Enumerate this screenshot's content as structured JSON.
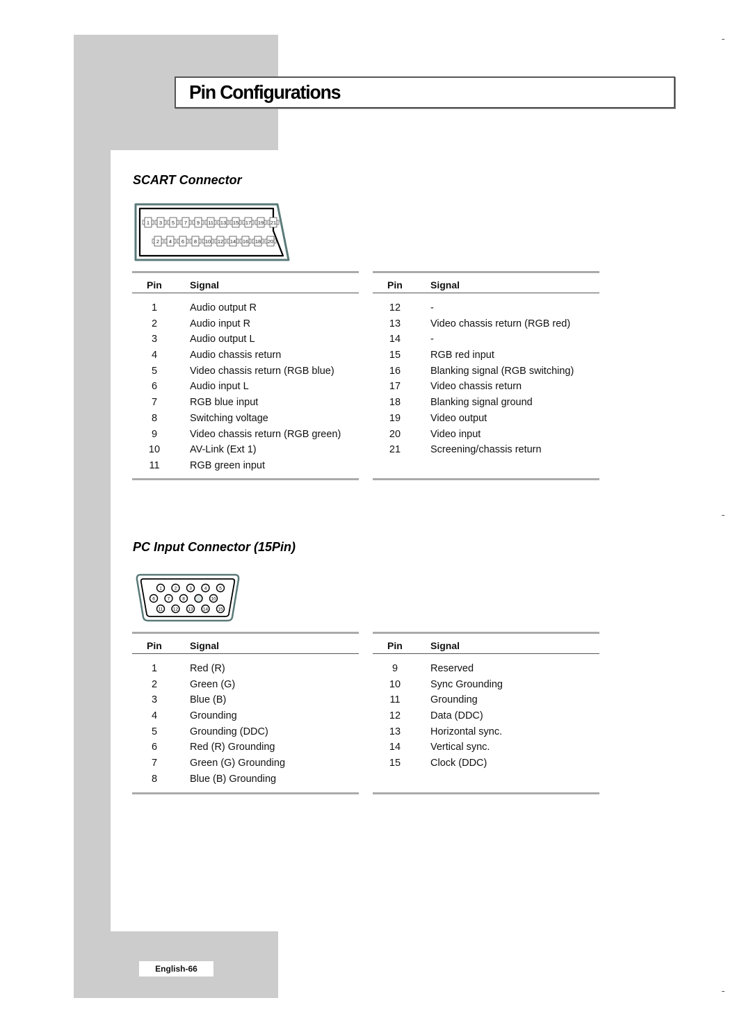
{
  "page": {
    "title": "Pin Configurations",
    "footer": "English-66"
  },
  "scart": {
    "section_title": "SCART Connector",
    "diagram": {
      "top_row_pins": [
        "1",
        "3",
        "5",
        "7",
        "9",
        "11",
        "13",
        "15",
        "17",
        "19",
        "21"
      ],
      "bottom_row_pins": [
        "2",
        "4",
        "6",
        "8",
        "10",
        "12",
        "14",
        "16",
        "18",
        "20"
      ]
    },
    "left_table": {
      "header_pin": "Pin",
      "header_signal": "Signal",
      "rows": [
        {
          "pin": "1",
          "signal": "Audio output R"
        },
        {
          "pin": "2",
          "signal": "Audio input R"
        },
        {
          "pin": "3",
          "signal": "Audio output L"
        },
        {
          "pin": "4",
          "signal": "Audio chassis return"
        },
        {
          "pin": "5",
          "signal": "Video chassis return (RGB blue)"
        },
        {
          "pin": "6",
          "signal": "Audio input L"
        },
        {
          "pin": "7",
          "signal": "RGB blue input"
        },
        {
          "pin": "8",
          "signal": "Switching voltage"
        },
        {
          "pin": "9",
          "signal": "Video chassis return (RGB green)"
        },
        {
          "pin": "10",
          "signal": "AV-Link (Ext 1)"
        },
        {
          "pin": "11",
          "signal": "RGB green input"
        }
      ]
    },
    "right_table": {
      "header_pin": "Pin",
      "header_signal": "Signal",
      "rows": [
        {
          "pin": "12",
          "signal": "-"
        },
        {
          "pin": "13",
          "signal": "Video chassis return (RGB red)"
        },
        {
          "pin": "14",
          "signal": "-"
        },
        {
          "pin": "15",
          "signal": "RGB red input"
        },
        {
          "pin": "16",
          "signal": "Blanking signal (RGB switching)"
        },
        {
          "pin": "17",
          "signal": "Video chassis return"
        },
        {
          "pin": "18",
          "signal": "Blanking signal ground"
        },
        {
          "pin": "19",
          "signal": "Video output"
        },
        {
          "pin": "20",
          "signal": "Video input"
        },
        {
          "pin": "21",
          "signal": "Screening/chassis return"
        }
      ]
    }
  },
  "pc": {
    "section_title": "PC Input Connector (15Pin)",
    "diagram": {
      "row1": [
        "1",
        "2",
        "3",
        "4",
        "5"
      ],
      "row2": [
        "6",
        "7",
        "8",
        "",
        "10"
      ],
      "row3": [
        "11",
        "12",
        "13",
        "14",
        "15"
      ]
    },
    "left_table": {
      "header_pin": "Pin",
      "header_signal": "Signal",
      "rows": [
        {
          "pin": "1",
          "signal": "Red (R)"
        },
        {
          "pin": "2",
          "signal": "Green (G)"
        },
        {
          "pin": "3",
          "signal": "Blue (B)"
        },
        {
          "pin": "4",
          "signal": "Grounding"
        },
        {
          "pin": "5",
          "signal": "Grounding (DDC)"
        },
        {
          "pin": "6",
          "signal": "Red (R) Grounding"
        },
        {
          "pin": "7",
          "signal": "Green (G) Grounding"
        },
        {
          "pin": "8",
          "signal": "Blue (B) Grounding"
        }
      ]
    },
    "right_table": {
      "header_pin": "Pin",
      "header_signal": "Signal",
      "rows": [
        {
          "pin": "9",
          "signal": "Reserved"
        },
        {
          "pin": "10",
          "signal": "Sync Grounding"
        },
        {
          "pin": "11",
          "signal": "Grounding"
        },
        {
          "pin": "12",
          "signal": "Data (DDC)"
        },
        {
          "pin": "13",
          "signal": "Horizontal sync."
        },
        {
          "pin": "14",
          "signal": "Vertical sync."
        },
        {
          "pin": "15",
          "signal": "Clock (DDC)"
        }
      ]
    }
  },
  "colors": {
    "panel_gray": "#cccccc",
    "connector_outline": "#5a7a78",
    "rule_gray": "#aaaaaa"
  }
}
